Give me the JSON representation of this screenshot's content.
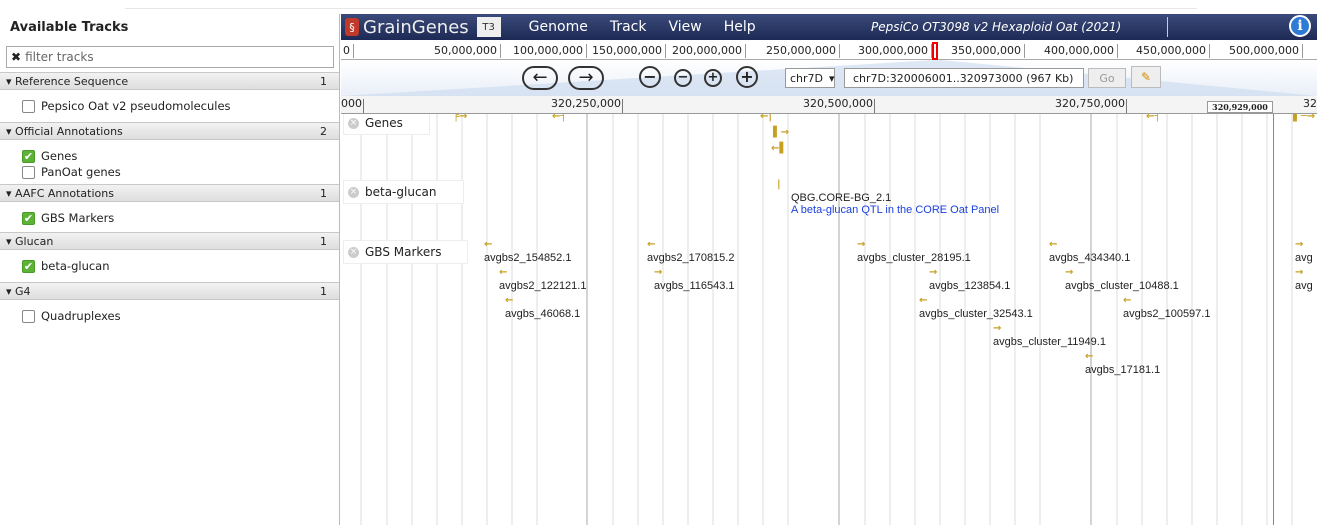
{
  "left_panel": {
    "title": "Available Tracks",
    "filter_placeholder": "filter tracks",
    "categories": [
      {
        "name": "Reference Sequence",
        "count": "1",
        "tracks": [
          {
            "label": "Pepsico Oat v2 pseudomolecules",
            "checked": false
          }
        ]
      },
      {
        "name": "Official Annotations",
        "count": "2",
        "tracks": [
          {
            "label": "Genes",
            "checked": true
          },
          {
            "label": "PanOat genes",
            "checked": false
          }
        ]
      },
      {
        "name": "AAFC Annotations",
        "count": "1",
        "tracks": [
          {
            "label": "GBS Markers",
            "checked": true
          }
        ]
      },
      {
        "name": "Glucan",
        "count": "1",
        "tracks": [
          {
            "label": "beta-glucan",
            "checked": true
          }
        ]
      },
      {
        "name": "G4",
        "count": "1",
        "tracks": [
          {
            "label": "Quadruplexes",
            "checked": false
          }
        ]
      }
    ]
  },
  "menubar": {
    "logo": "GrainGenes",
    "logo_badge": "T3",
    "menus": [
      "Genome",
      "Track",
      "View",
      "Help"
    ],
    "dataset": "PepsiCo OT3098 v2 Hexaploid Oat (2021)",
    "info_label": "i"
  },
  "overview": {
    "ticks": [
      "0",
      "50,000,000",
      "100,000,000",
      "150,000,000",
      "200,000,000",
      "250,000,000",
      "300,000,000",
      "350,000,000",
      "400,000,000",
      "450,000,000",
      "500,000,000"
    ]
  },
  "nav": {
    "chromosome": "chr7D",
    "location": "chr7D:320006001..320973000 (967 Kb)",
    "go_label": "Go"
  },
  "ruler": {
    "ticks": [
      "000",
      "320,250,000",
      "320,500,000",
      "320,750,000",
      "32"
    ],
    "position_box": "320,929,000"
  },
  "tracks": {
    "genes": {
      "label": "Genes"
    },
    "beta_glucan": {
      "label": "beta-glucan",
      "feature": "QBG.CORE-BG_2.1",
      "description": "A beta-glucan QTL in the CORE Oat Panel"
    },
    "gbs": {
      "label": "GBS Markers",
      "features": [
        "avgbs2_154852.1",
        "avgbs2_122121.1",
        "avgbs_46068.1",
        "avgbs2_170815.2",
        "avgbs_116543.1",
        "avgbs_cluster_28195.1",
        "avgbs_123854.1",
        "avgbs_cluster_32543.1",
        "avgbs_cluster_11949.1",
        "avgbs_434340.1",
        "avgbs_cluster_10488.1",
        "avgbs2_100597.1",
        "avgbs_17181.1",
        "avg",
        "avg"
      ]
    }
  },
  "colors": {
    "menubar": "#1e2a55",
    "checked": "#5cb338",
    "feature_glyph": "#c8a020",
    "description": "#1a3fe0",
    "highlight": "#ee0000"
  }
}
